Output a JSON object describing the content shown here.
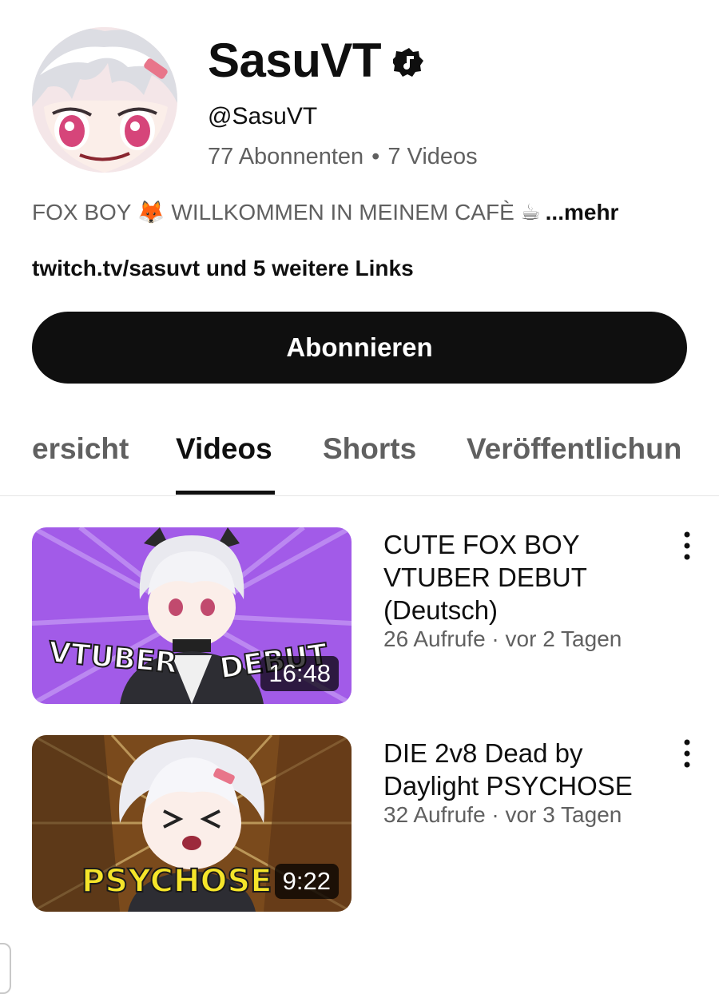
{
  "channel": {
    "name": "SasuVT",
    "verified_icon": "verified-music-badge-icon",
    "handle": "@SasuVT",
    "subscribers": "77 Abonnenten",
    "separator": "•",
    "videos_count": "7 Videos",
    "description": "FOX BOY 🦊 WILLKOMMEN IN MEINEM CAFÈ ☕",
    "more_label": "...mehr",
    "links_text": "twitch.tv/sasuvt und 5 weitere Links"
  },
  "subscribe_button": {
    "label": "Abonnieren"
  },
  "tabs": [
    {
      "label": "ersicht",
      "active": false
    },
    {
      "label": "Videos",
      "active": true
    },
    {
      "label": "Shorts",
      "active": false
    },
    {
      "label": "Veröffentlichun",
      "active": false
    }
  ],
  "videos": [
    {
      "title": "CUTE FOX BOY VTUBER DEBUT (Deutsch)",
      "meta": "26 Aufrufe · vor 2 Tagen",
      "duration": "16:48",
      "thumb_text_left": "VTUBER",
      "thumb_text_right": "DEBUT",
      "thumb_color": "#a25be8"
    },
    {
      "title": "DIE 2v8 Dead by Daylight PSYCHOSE",
      "meta": "32 Aufrufe · vor 3 Tagen",
      "duration": "9:22",
      "thumb_text": "PSYCHOSE",
      "thumb_color": "#7a4a1c"
    }
  ],
  "colors": {
    "text_primary": "#0f0f0f",
    "text_secondary": "#606060",
    "button_bg": "#0f0f0f",
    "divider": "#e5e5e5"
  }
}
